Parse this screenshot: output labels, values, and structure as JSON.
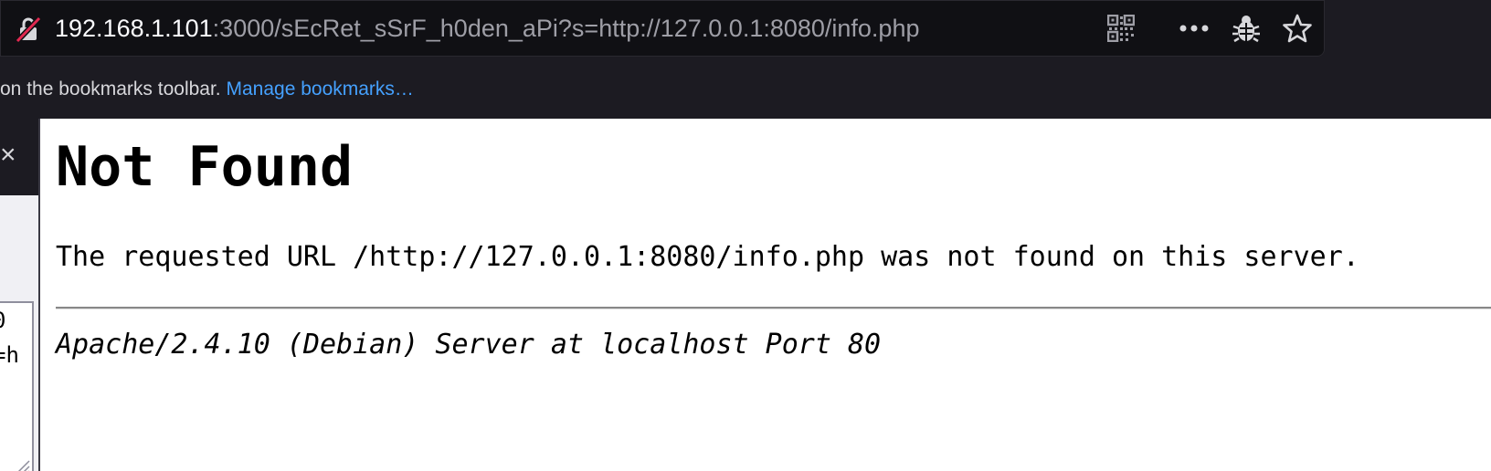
{
  "urlbar": {
    "host": "192.168.1.101",
    "rest": ":3000/sEcRet_sSrF_h0den_aPi?s=http://127.0.0.1:8080/info.php",
    "icons": [
      "insecure-lock-icon",
      "qr-code-icon",
      "more-options-icon",
      "bug-icon",
      "bookmark-star-icon"
    ]
  },
  "bookmarks_bar": {
    "message": "on the bookmarks toolbar.",
    "link": "Manage bookmarks…"
  },
  "sidebar": {
    "close": "×",
    "textarea_lines": [
      "0",
      "=h"
    ]
  },
  "page": {
    "heading": "Not Found",
    "message": "The requested URL /http://127.0.0.1:8080/info.php was not found on this server.",
    "address": "Apache/2.4.10 (Debian) Server at localhost Port 80"
  },
  "colors": {
    "url_host": "#fbfbfe",
    "url_rest": "#9e9ea6",
    "link": "#45a1ff",
    "insecure_slash": "#e22850"
  }
}
